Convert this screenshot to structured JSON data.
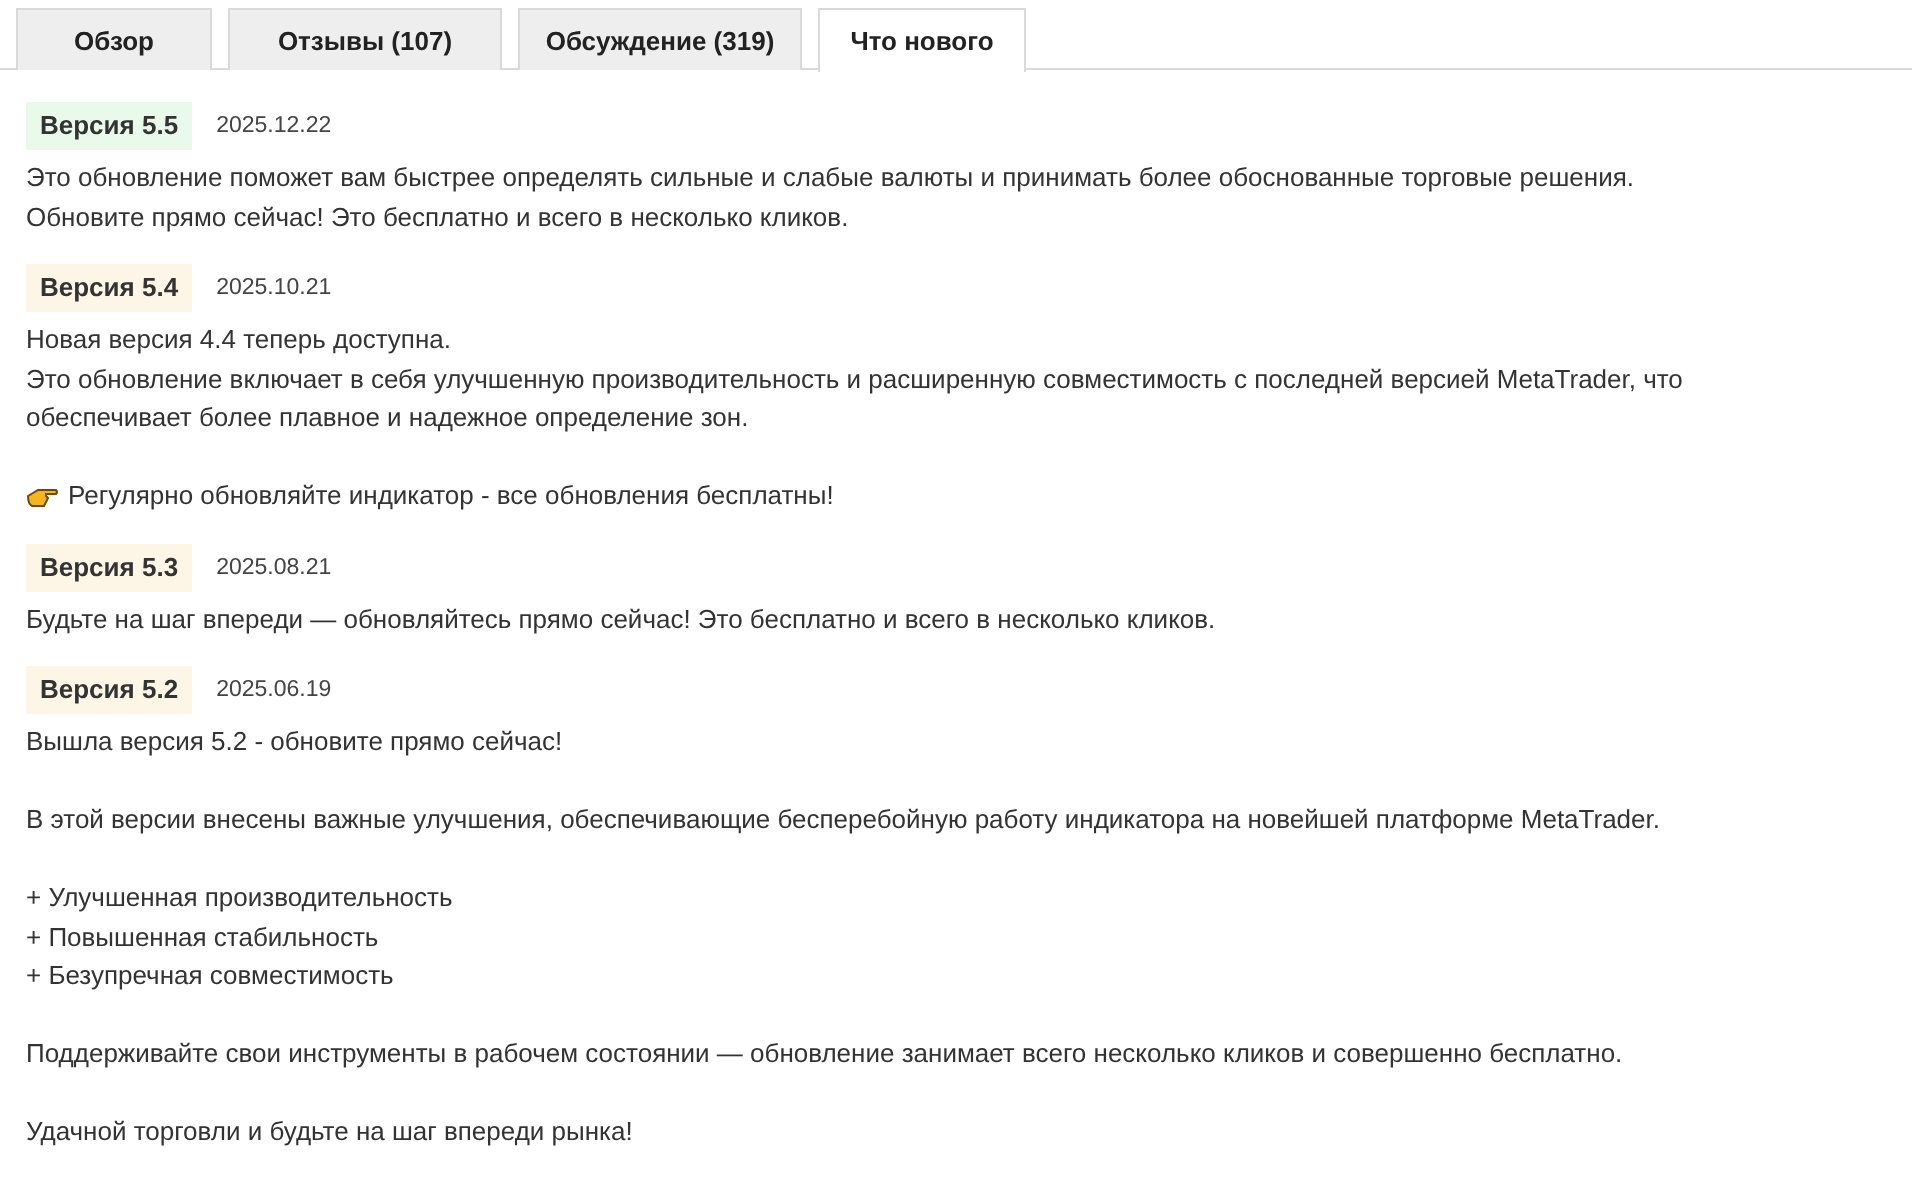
{
  "tabs": [
    {
      "label": "Обзор",
      "selected": false
    },
    {
      "label": "Отзывы (107)",
      "selected": false
    },
    {
      "label": "Обсуждение (319)",
      "selected": false
    },
    {
      "label": "Что нового",
      "selected": true
    }
  ],
  "versions": [
    {
      "version": "Версия 5.5",
      "date": "2025.12.22",
      "color": "#eafaea",
      "paragraphs": [
        {
          "kind": "text",
          "lines": [
            "Это обновление поможет вам быстрее определять сильные и слабые валюты и принимать более обоснованные торговые решения.",
            "Обновите прямо сейчас! Это бесплатно и всего в несколько кликов."
          ]
        }
      ]
    },
    {
      "version": "Версия 5.4",
      "date": "2025.10.21",
      "color": "#fdf6e6",
      "paragraphs": [
        {
          "kind": "text",
          "lines": [
            "Новая версия 4.4 теперь доступна.",
            "Это обновление включает в себя улучшенную производительность и расширенную совместимость с последней версией MetaTrader, что",
            "обеспечивает более плавное и надежное определение зон."
          ]
        },
        {
          "kind": "tip",
          "lines": [
            "Регулярно обновляйте индикатор - все обновления бесплатны!"
          ]
        }
      ]
    },
    {
      "version": "Версия 5.3",
      "date": "2025.08.21",
      "color": "#fdf6e6",
      "paragraphs": [
        {
          "kind": "text",
          "lines": [
            "Будьте на шаг впереди — обновляйтесь прямо сейчас! Это бесплатно и всего в несколько кликов."
          ]
        }
      ]
    },
    {
      "version": "Версия 5.2",
      "date": "2025.06.19",
      "color": "#fdf6e6",
      "paragraphs": [
        {
          "kind": "text",
          "lines": [
            "Вышла версия 5.2 - обновите прямо сейчас!"
          ]
        },
        {
          "kind": "text",
          "lines": [
            "В этой версии внесены важные улучшения, обеспечивающие бесперебойную работу индикатора на новейшей платформе MetaTrader."
          ]
        },
        {
          "kind": "text",
          "lines": [
            "+ Улучшенная производительность",
            "+ Повышенная стабильность",
            "+ Безупречная совместимость"
          ]
        },
        {
          "kind": "text",
          "lines": [
            "Поддерживайте свои инструменты в рабочем состоянии — обновление занимает всего несколько кликов и совершенно бесплатно."
          ]
        },
        {
          "kind": "text",
          "lines": [
            "Удачной торговли и будьте на шаг впереди рынка!"
          ]
        }
      ]
    }
  ]
}
